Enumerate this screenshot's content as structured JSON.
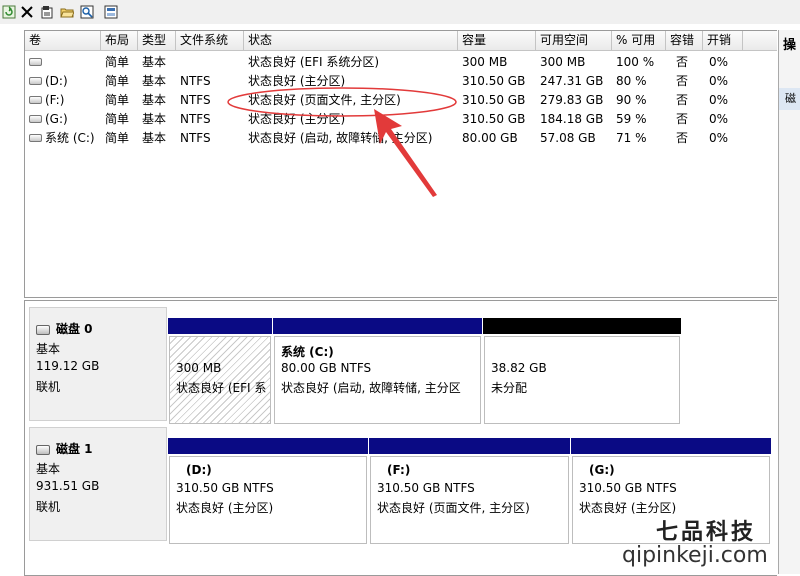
{
  "columns": [
    "卷",
    "布局",
    "类型",
    "文件系统",
    "状态",
    "容量",
    "可用空间",
    "% 可用",
    "容错",
    "开销"
  ],
  "volumes": [
    {
      "vol": "",
      "layout": "简单",
      "type": "基本",
      "fs": "",
      "status": "状态良好 (EFI 系统分区)",
      "cap": "300 MB",
      "free": "300 MB",
      "pct": "100 %",
      "ft": "否",
      "ov": "0%"
    },
    {
      "vol": "(D:)",
      "layout": "简单",
      "type": "基本",
      "fs": "NTFS",
      "status": "状态良好 (主分区)",
      "cap": "310.50 GB",
      "free": "247.31 GB",
      "pct": "80 %",
      "ft": "否",
      "ov": "0%"
    },
    {
      "vol": "(F:)",
      "layout": "简单",
      "type": "基本",
      "fs": "NTFS",
      "status": "状态良好 (页面文件, 主分区)",
      "cap": "310.50 GB",
      "free": "279.83 GB",
      "pct": "90 %",
      "ft": "否",
      "ov": "0%"
    },
    {
      "vol": "(G:)",
      "layout": "简单",
      "type": "基本",
      "fs": "NTFS",
      "status": "状态良好 (主分区)",
      "cap": "310.50 GB",
      "free": "184.18 GB",
      "pct": "59 %",
      "ft": "否",
      "ov": "0%"
    },
    {
      "vol": "系统 (C:)",
      "layout": "简单",
      "type": "基本",
      "fs": "NTFS",
      "status": "状态良好 (启动, 故障转储, 主分区)",
      "cap": "80.00 GB",
      "free": "57.08 GB",
      "pct": "71 %",
      "ft": "否",
      "ov": "0%"
    }
  ],
  "right_panel": {
    "title": "操",
    "sub": "磁"
  },
  "disks": [
    {
      "name": "磁盘 0",
      "type": "基本",
      "size": "119.12 GB",
      "status": "联机",
      "partitions": [
        {
          "title": "",
          "size": "300 MB",
          "status": "状态良好 (EFI 系"
        },
        {
          "title": "系统  (C:)",
          "size": "80.00 GB NTFS",
          "status": "状态良好 (启动, 故障转储, 主分区"
        },
        {
          "title": "",
          "size": "38.82 GB",
          "status": "未分配"
        }
      ]
    },
    {
      "name": "磁盘 1",
      "type": "基本",
      "size": "931.51 GB",
      "status": "联机",
      "partitions": [
        {
          "title": "(D:)",
          "size": "310.50 GB NTFS",
          "status": "状态良好 (主分区)"
        },
        {
          "title": "(F:)",
          "size": "310.50 GB NTFS",
          "status": "状态良好 (页面文件, 主分区)"
        },
        {
          "title": "(G:)",
          "size": "310.50 GB NTFS",
          "status": "状态良好 (主分区)"
        }
      ]
    }
  ],
  "watermark": {
    "name": "七品科技",
    "url": "qipinkeji.com"
  },
  "colors": {
    "partition_bar": "#0a0a84",
    "unallocated_bar": "#000000",
    "annotation": "#e23a3a"
  }
}
